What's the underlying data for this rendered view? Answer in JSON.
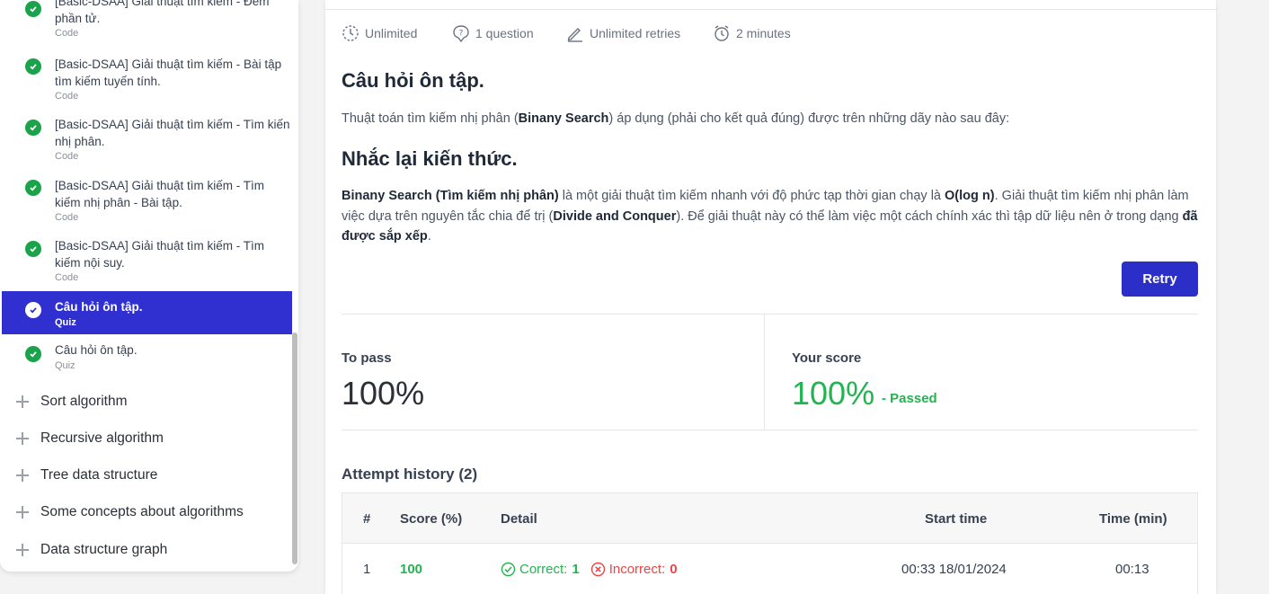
{
  "sidebar": {
    "lessons": [
      {
        "title": "[Basic-DSAA] Giải thuật tìm kiếm - Đếm phần tử.",
        "type": "Code"
      },
      {
        "title": "[Basic-DSAA] Giải thuật tìm kiếm - Bài tập tìm kiếm tuyến tính.",
        "type": "Code"
      },
      {
        "title": "[Basic-DSAA] Giải thuật tìm kiếm - Tìm kiến nhị phân.",
        "type": "Code"
      },
      {
        "title": "[Basic-DSAA] Giải thuật tìm kiếm - Tìm kiếm nhị phân - Bài tập.",
        "type": "Code"
      },
      {
        "title": "[Basic-DSAA] Giải thuật tìm kiếm - Tìm kiếm nội suy.",
        "type": "Code"
      },
      {
        "title": "Câu hỏi ôn tập.",
        "type": "Quiz"
      },
      {
        "title": "Câu hỏi ôn tập.",
        "type": "Quiz"
      }
    ],
    "sections": [
      "Sort algorithm",
      "Recursive algorithm",
      "Tree data structure",
      "Some concepts about algorithms",
      "Data structure graph"
    ]
  },
  "meta": {
    "duration": "Unlimited",
    "questions": "1 question",
    "retries": "Unlimited retries",
    "time": "2 minutes"
  },
  "content": {
    "heading1": "Câu hỏi ôn tập.",
    "question_pre": "Thuật toán tìm kiếm nhị phân (",
    "question_bold": "Binany Search",
    "question_post": ") áp dụng (phải cho kết quả đúng) được trên những dãy nào sau đây:",
    "heading2": "Nhắc lại kiến thức.",
    "p_bold1": "Binany Search (Tìm kiếm nhị phân)",
    "p_text1": " là một giải thuật tìm kiếm nhanh với độ phức tạp thời gian chạy là ",
    "p_bold2": "O(log n)",
    "p_text2": ". Giải thuật tìm kiếm nhị phân làm việc dựa trên nguyên tắc chia để trị (",
    "p_bold3": "Divide and Conquer",
    "p_text3": "). Để giải thuật này có thể làm việc một cách chính xác thì tập dữ liệu nên ở trong dạng ",
    "p_bold4": "đã được sắp xếp",
    "p_text4": "."
  },
  "retry_label": "Retry",
  "result": {
    "to_pass_label": "To pass",
    "to_pass_value": "100%",
    "score_label": "Your score",
    "score_value": "100%",
    "status": "- Passed"
  },
  "history": {
    "title": "Attempt history (2)",
    "columns": [
      "#",
      "Score (%)",
      "Detail",
      "Start time",
      "Time (min)"
    ],
    "rows": [
      {
        "num": "1",
        "score": "100",
        "correct_label": "Correct:",
        "correct": "1",
        "incorrect_label": "Incorrect:",
        "incorrect": "0",
        "start": "00:33 18/01/2024",
        "time": "00:13"
      }
    ]
  },
  "colors": {
    "active": "#3030d0",
    "success": "#22b451",
    "error": "#ef4444",
    "button": "#2b2fc8"
  }
}
